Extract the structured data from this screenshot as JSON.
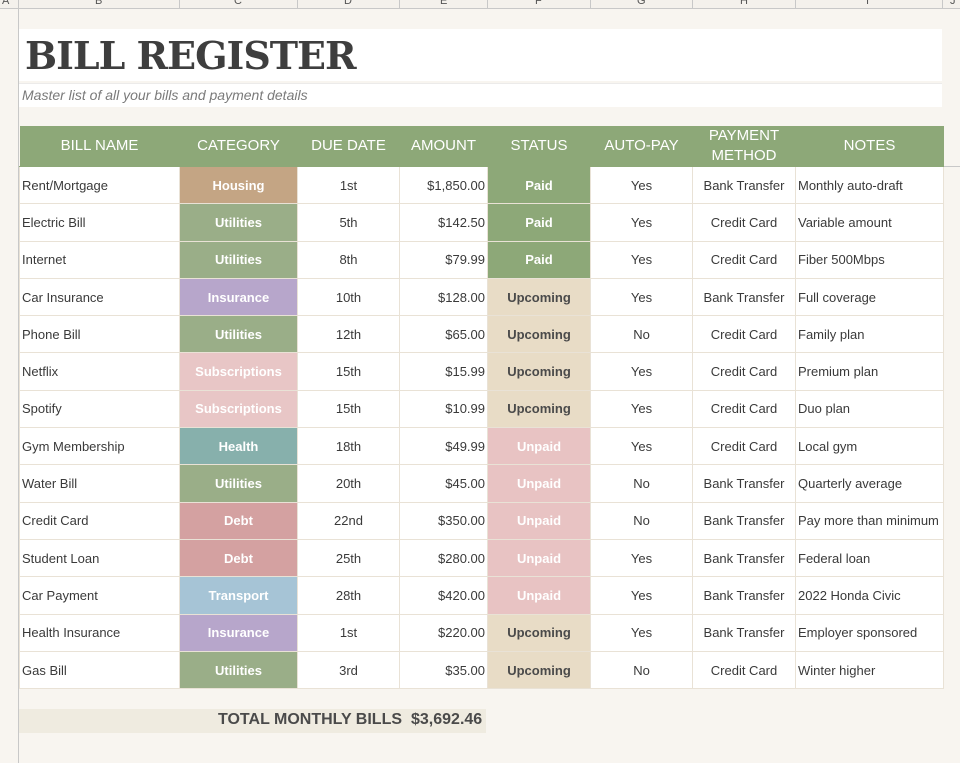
{
  "sheet": {
    "column_letters": [
      "A",
      "B",
      "C",
      "D",
      "E",
      "F",
      "G",
      "H",
      "I",
      "J"
    ],
    "title": "BILL REGISTER",
    "subtitle": "Master list of all your bills and payment details"
  },
  "table": {
    "headers": {
      "bill_name": "BILL NAME",
      "category": "CATEGORY",
      "due_date": "DUE DATE",
      "amount": "AMOUNT",
      "status": "STATUS",
      "autopay": "AUTO-PAY",
      "payment_method_line1": "PAYMENT",
      "payment_method_line2": "METHOD",
      "notes": "NOTES"
    },
    "category_colors": {
      "Housing": "#c4a584",
      "Utilities": "#9aae88",
      "Insurance": "#b7a6cb",
      "Subscriptions": "#e8c6c6",
      "Health": "#87b0ac",
      "Debt": "#d4a1a1",
      "Transport": "#a6c4d6"
    },
    "status_colors": {
      "Paid": "#8da878",
      "Upcoming": "#e8dcc6",
      "Unpaid": "#e8c3c3"
    },
    "rows": [
      {
        "name": "Rent/Mortgage",
        "category": "Housing",
        "due": "1st",
        "amount": "$1,850.00",
        "status": "Paid",
        "autopay": "Yes",
        "method": "Bank Transfer",
        "notes": "Monthly auto-draft"
      },
      {
        "name": "Electric Bill",
        "category": "Utilities",
        "due": "5th",
        "amount": "$142.50",
        "status": "Paid",
        "autopay": "Yes",
        "method": "Credit Card",
        "notes": "Variable amount"
      },
      {
        "name": "Internet",
        "category": "Utilities",
        "due": "8th",
        "amount": "$79.99",
        "status": "Paid",
        "autopay": "Yes",
        "method": "Credit Card",
        "notes": "Fiber 500Mbps"
      },
      {
        "name": "Car Insurance",
        "category": "Insurance",
        "due": "10th",
        "amount": "$128.00",
        "status": "Upcoming",
        "autopay": "Yes",
        "method": "Bank Transfer",
        "notes": "Full coverage"
      },
      {
        "name": "Phone Bill",
        "category": "Utilities",
        "due": "12th",
        "amount": "$65.00",
        "status": "Upcoming",
        "autopay": "No",
        "method": "Credit Card",
        "notes": "Family plan"
      },
      {
        "name": "Netflix",
        "category": "Subscriptions",
        "due": "15th",
        "amount": "$15.99",
        "status": "Upcoming",
        "autopay": "Yes",
        "method": "Credit Card",
        "notes": "Premium plan"
      },
      {
        "name": "Spotify",
        "category": "Subscriptions",
        "due": "15th",
        "amount": "$10.99",
        "status": "Upcoming",
        "autopay": "Yes",
        "method": "Credit Card",
        "notes": "Duo plan"
      },
      {
        "name": "Gym Membership",
        "category": "Health",
        "due": "18th",
        "amount": "$49.99",
        "status": "Unpaid",
        "autopay": "Yes",
        "method": "Credit Card",
        "notes": "Local gym"
      },
      {
        "name": "Water Bill",
        "category": "Utilities",
        "due": "20th",
        "amount": "$45.00",
        "status": "Unpaid",
        "autopay": "No",
        "method": "Bank Transfer",
        "notes": "Quarterly average"
      },
      {
        "name": "Credit Card",
        "category": "Debt",
        "due": "22nd",
        "amount": "$350.00",
        "status": "Unpaid",
        "autopay": "No",
        "method": "Bank Transfer",
        "notes": "Pay more than minimum"
      },
      {
        "name": "Student Loan",
        "category": "Debt",
        "due": "25th",
        "amount": "$280.00",
        "status": "Unpaid",
        "autopay": "Yes",
        "method": "Bank Transfer",
        "notes": "Federal loan"
      },
      {
        "name": "Car Payment",
        "category": "Transport",
        "due": "28th",
        "amount": "$420.00",
        "status": "Unpaid",
        "autopay": "Yes",
        "method": "Bank Transfer",
        "notes": "2022 Honda Civic"
      },
      {
        "name": "Health Insurance",
        "category": "Insurance",
        "due": "1st",
        "amount": "$220.00",
        "status": "Upcoming",
        "autopay": "Yes",
        "method": "Bank Transfer",
        "notes": "Employer sponsored"
      },
      {
        "name": "Gas Bill",
        "category": "Utilities",
        "due": "3rd",
        "amount": "$35.00",
        "status": "Upcoming",
        "autopay": "No",
        "method": "Credit Card",
        "notes": "Winter higher"
      }
    ]
  },
  "total": {
    "label": "TOTAL MONTHLY BILLS",
    "value": "$3,692.46"
  }
}
